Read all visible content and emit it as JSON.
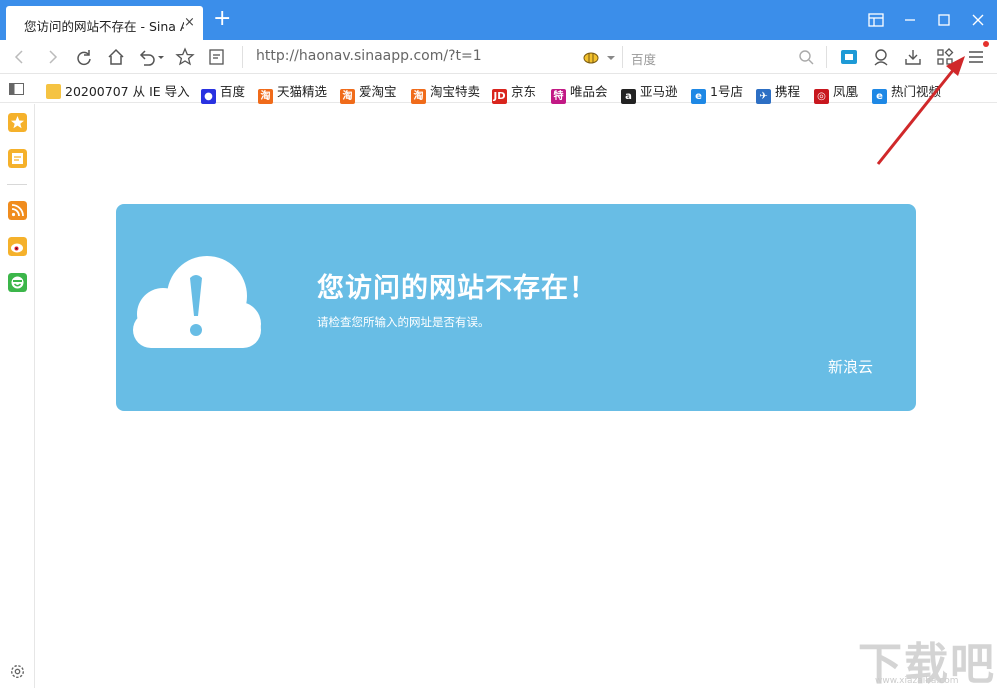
{
  "tab": {
    "title": "您访问的网站不存在 - Sina A",
    "close": "×",
    "new_tab": "+"
  },
  "navbar": {
    "url": "http://haonav.sinaapp.com/?t=1",
    "search_placeholder": "百度"
  },
  "tooltip": "菜单",
  "bookmarks": [
    {
      "label": "20200707 从 IE 导入",
      "icon": "folder-icon",
      "color": "#f5c342"
    },
    {
      "label": "百度",
      "icon": "baidu-icon",
      "color": "#2932e1"
    },
    {
      "label": "天猫精选",
      "icon": "taobao-icon",
      "color": "#f06b1a"
    },
    {
      "label": "爱淘宝",
      "icon": "taobao-icon",
      "color": "#f06b1a"
    },
    {
      "label": "淘宝特卖",
      "icon": "taobao-icon",
      "color": "#f06b1a"
    },
    {
      "label": "京东",
      "icon": "jd-icon",
      "color": "#d9251d"
    },
    {
      "label": "唯品会",
      "icon": "vip-icon",
      "color": "#c21985"
    },
    {
      "label": "亚马逊",
      "icon": "amazon-icon",
      "color": "#222222"
    },
    {
      "label": "1号店",
      "icon": "ie-icon",
      "color": "#1e88e5"
    },
    {
      "label": "携程",
      "icon": "ctrip-icon",
      "color": "#2d6fc4"
    },
    {
      "label": "凤凰",
      "icon": "ifeng-icon",
      "color": "#c8171e"
    },
    {
      "label": "热门视频",
      "icon": "ie-icon",
      "color": "#1e88e5"
    }
  ],
  "error": {
    "title": "您访问的网站不存在！",
    "subtitle": "请检查您所输入的网址是否有误。",
    "brand": "新浪云"
  },
  "colors": {
    "tabbar": "#3b8eea",
    "card": "#68bde5",
    "arrow": "#d0282a"
  },
  "watermark": {
    "text": "下载吧",
    "url": "www.xiazaiba.com"
  }
}
